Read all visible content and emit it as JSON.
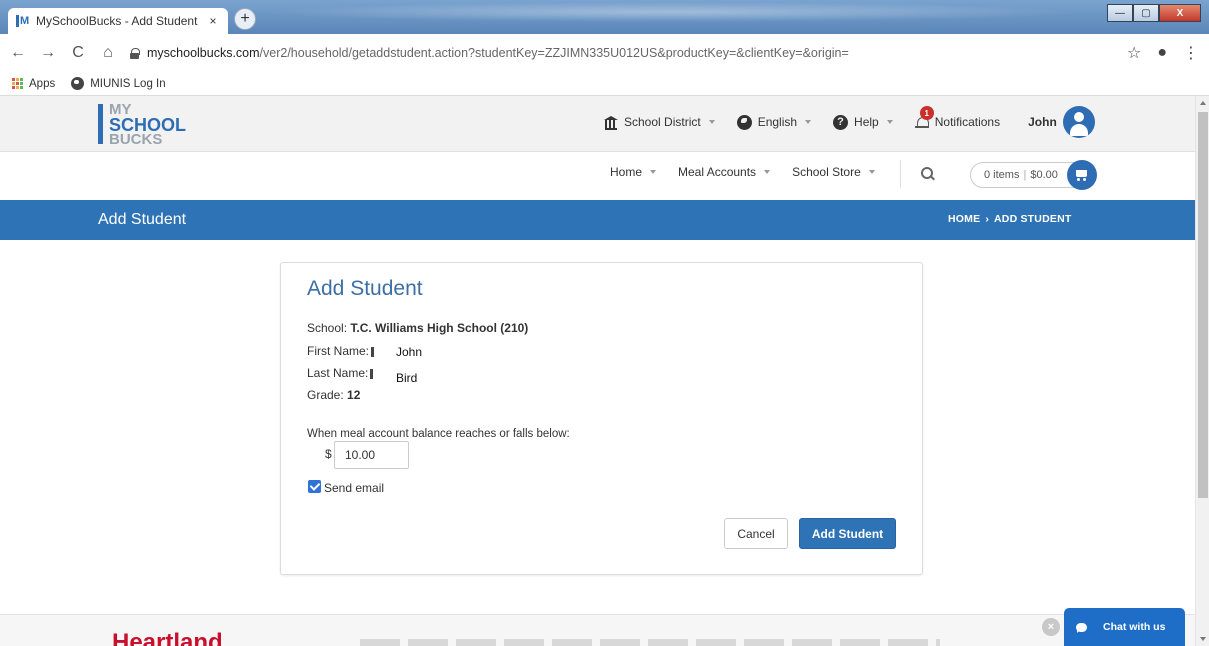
{
  "browser": {
    "tab_title": "MySchoolBucks - Add Student",
    "tab_close": "×",
    "new_tab": "+",
    "url_host": "myschoolbucks.com",
    "url_rest": "/ver2/household/getaddstudent.action?studentKey=ZZJIMN335U012US&productKey=&clientKey=&origin=",
    "nav": {
      "back": "←",
      "forward": "→",
      "reload": "C",
      "home": "⌂",
      "star": "☆",
      "account": "●",
      "menu": "⋮"
    },
    "bookmarks": [
      {
        "label": "Apps",
        "icon": "apps-icon"
      },
      {
        "label": "MIUNIS Log In",
        "icon": "globe-icon"
      }
    ],
    "window": {
      "minimize": "—",
      "maximize": "▢",
      "close": "X"
    }
  },
  "site": {
    "logo": {
      "line1": "MY",
      "line2": "SCHOOL",
      "line3": "BUCKS"
    },
    "top_menu": {
      "school_district": "School District",
      "language": "English",
      "help": "Help",
      "notifications": "Notifications",
      "notifications_count": "1",
      "user_name": "John"
    },
    "nav_menu": {
      "home": "Home",
      "meal_accounts": "Meal Accounts",
      "school_store": "School Store"
    },
    "cart": {
      "items": "0 items",
      "divider": "|",
      "total": "$0.00"
    },
    "page_bar": {
      "title": "Add Student",
      "crumb_home": "HOME",
      "crumb_sep": "›",
      "crumb_current": "ADD STUDENT"
    }
  },
  "form": {
    "title": "Add Student",
    "school_label": "School:",
    "school_value": "T.C. Williams High School (210)",
    "first_name_label": "First Name:",
    "first_name_value": "John",
    "last_name_label": "Last Name:",
    "last_name_value": "Bird",
    "grade_label": "Grade:",
    "grade_value": "12",
    "threshold_label": "When meal account balance reaches or falls below:",
    "currency_symbol": "$",
    "threshold_amount": "10.00",
    "send_email_label": "Send email",
    "send_email_checked": true,
    "cancel_label": "Cancel",
    "submit_label": "Add Student"
  },
  "footer": {
    "logo_text": "Heartland",
    "chat_label": "Chat with us",
    "chat_dismiss": "×"
  },
  "colors": {
    "brand_blue": "#2e73b5",
    "title_blue": "#3c6fa3",
    "notification_red": "#c9302c",
    "footer_logo_red": "#c8102e"
  }
}
